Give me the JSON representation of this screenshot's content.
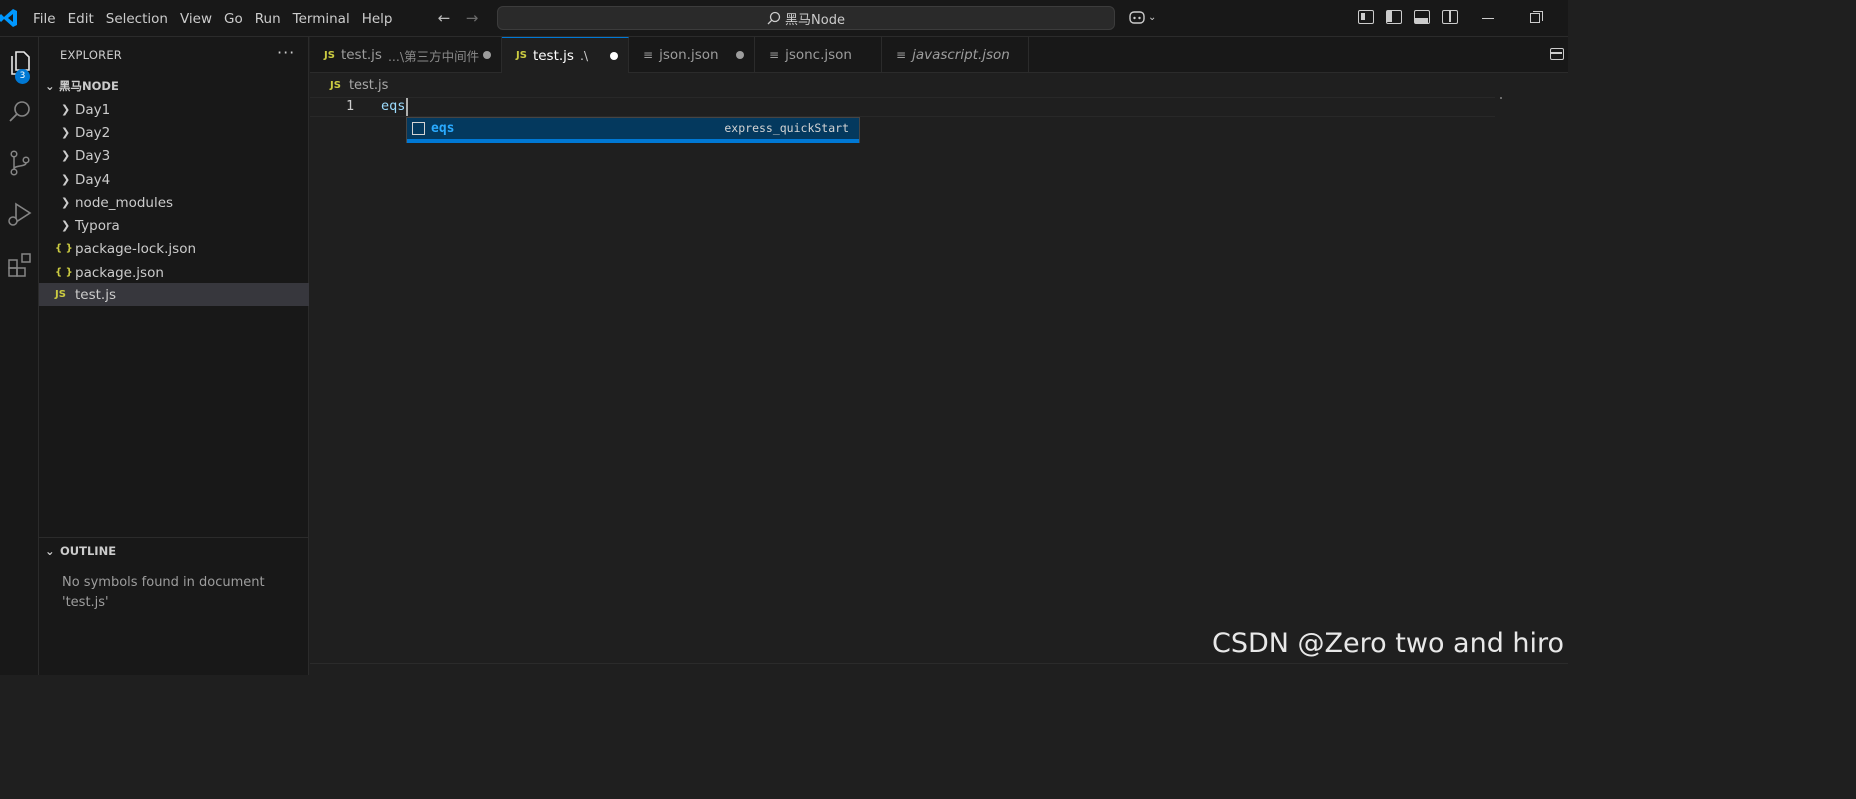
{
  "menu": [
    "File",
    "Edit",
    "Selection",
    "View",
    "Go",
    "Run",
    "Terminal",
    "Help"
  ],
  "command_center": {
    "label": "黑马Node"
  },
  "activity_bar": {
    "explorer_badge": "3"
  },
  "explorer": {
    "header": "EXPLORER",
    "folder": "黑马NODE",
    "items": [
      {
        "label": "Day1",
        "type": "folder"
      },
      {
        "label": "Day2",
        "type": "folder"
      },
      {
        "label": "Day3",
        "type": "folder"
      },
      {
        "label": "Day4",
        "type": "folder"
      },
      {
        "label": "node_modules",
        "type": "folder"
      },
      {
        "label": "Typora",
        "type": "folder"
      },
      {
        "label": "package-lock.json",
        "type": "json",
        "icon": "{ }"
      },
      {
        "label": "package.json",
        "type": "json",
        "icon": "{ }"
      },
      {
        "label": "test.js",
        "type": "js",
        "icon": "JS"
      }
    ]
  },
  "outline": {
    "title": "OUTLINE",
    "message": "No symbols found in document 'test.js'"
  },
  "tabs": [
    {
      "icon": "JS",
      "label": "test.js",
      "desc": "...\\第三方中间件"
    },
    {
      "icon": "JS",
      "label": "test.js",
      "desc": ".\\"
    },
    {
      "icon": "≡",
      "label": "json.json",
      "desc": ""
    },
    {
      "icon": "≡",
      "label": "jsonc.json",
      "desc": ""
    },
    {
      "icon": "≡",
      "label": "javascript.json",
      "desc": ""
    }
  ],
  "breadcrumb": {
    "icon": "JS",
    "file": "test.js"
  },
  "editor": {
    "line_number": "1",
    "code": "eqs"
  },
  "suggest": {
    "label": "eqs",
    "detail": "express_quickStart"
  },
  "watermark": "CSDN @Zero two and hiro",
  "colors": {
    "accent": "#0078d4",
    "background": "#1f1f1f",
    "sidebar": "#181818",
    "suggest_label": "#2aaaff"
  }
}
